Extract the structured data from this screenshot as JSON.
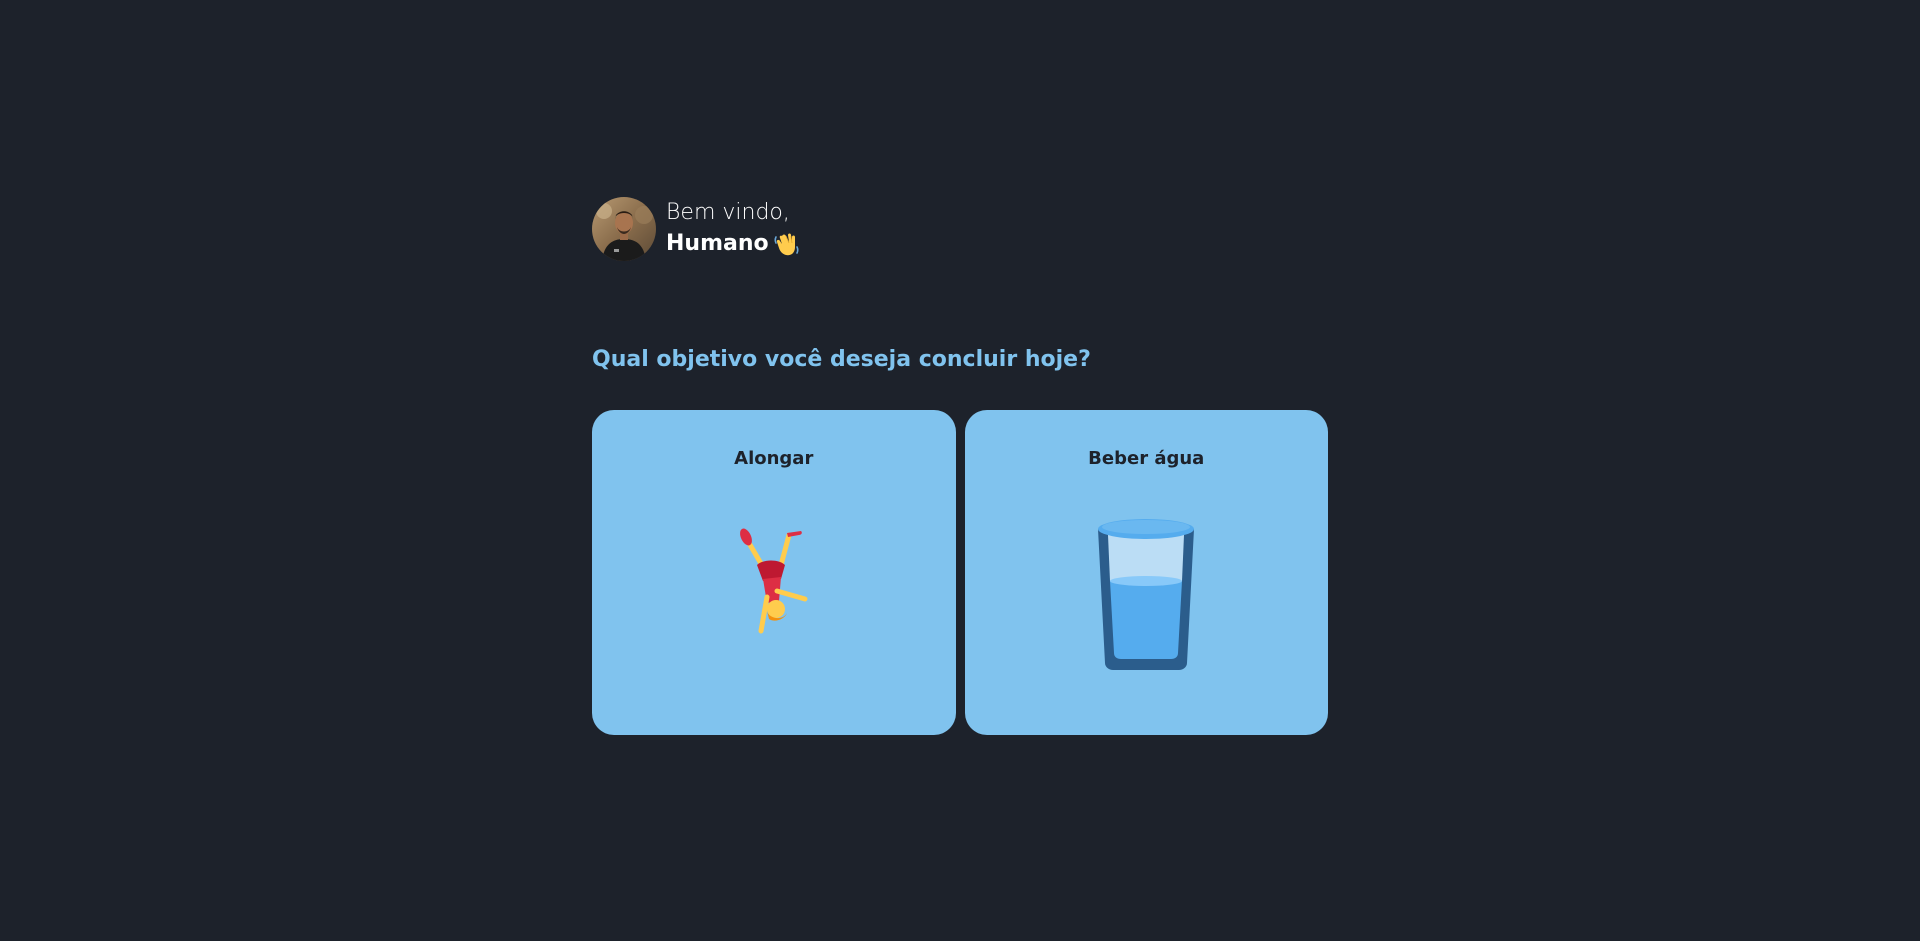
{
  "header": {
    "greeting": "Bem vindo,",
    "name": "Humano",
    "avatar_icon": "user-avatar-photo",
    "wave_icon": "waving-hand-icon"
  },
  "main": {
    "question": "Qual objetivo você deseja concluir hoje?"
  },
  "goals": [
    {
      "label": "Alongar",
      "icon": "cartwheel-person-icon"
    },
    {
      "label": "Beber água",
      "icon": "water-glass-icon"
    }
  ],
  "colors": {
    "background": "#1d222b",
    "accent": "#80c3ee",
    "card_text": "#1d222b",
    "text": "#ffffff"
  }
}
